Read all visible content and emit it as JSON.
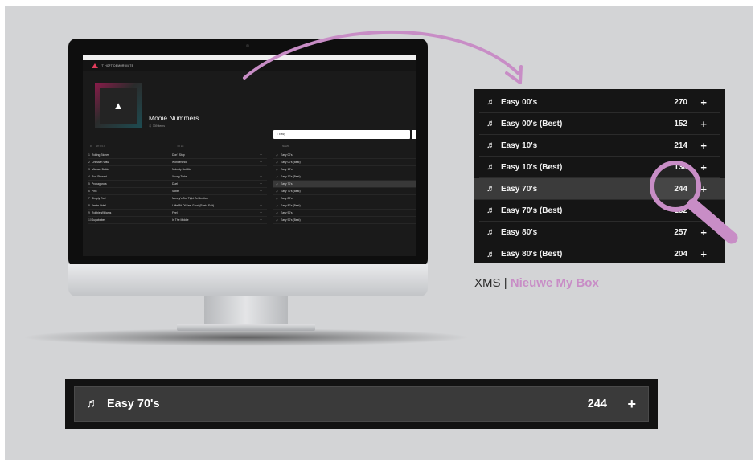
{
  "colors": {
    "accent_pink": "#c88dc6",
    "brand_red": "#e23d5c",
    "panel_dark": "#151515",
    "row_highlight": "#3b3b3b"
  },
  "app": {
    "brand": "'T HOFT DEMORUIMTE",
    "playlist": {
      "title": "Mooie Nummers",
      "meta": "339 items"
    },
    "search": {
      "value": "Easy"
    },
    "columns": {
      "number": "#",
      "artist": "ARTIST",
      "title": "TITLE",
      "name": "NAME"
    },
    "tracks": [
      {
        "num": "1",
        "artist": "Rolling Stones",
        "title": "Don't Stop"
      },
      {
        "num": "2",
        "artist": "Christian Walz",
        "title": "Wonderchild"
      },
      {
        "num": "3",
        "artist": "Michael Buble",
        "title": "Nobody But Me"
      },
      {
        "num": "4",
        "artist": "Rod Stewart",
        "title": "Young Turks"
      },
      {
        "num": "5",
        "artist": "Propaganda",
        "title": "Duel"
      },
      {
        "num": "6",
        "artist": "Pink",
        "title": "Sober"
      },
      {
        "num": "7",
        "artist": "Simply Red",
        "title": "Money's Too Tight To Mention"
      },
      {
        "num": "8",
        "artist": "Jamie Lidell",
        "title": "Little Bit Of Feel Good (Basta Edit)"
      },
      {
        "num": "9",
        "artist": "Robbie Williams",
        "title": "Feel"
      },
      {
        "num": "10",
        "artist": "Sugababes",
        "title": "In The Middle"
      }
    ],
    "library": [
      {
        "name": "Easy 00's"
      },
      {
        "name": "Easy 00's (Best)"
      },
      {
        "name": "Easy 10's"
      },
      {
        "name": "Easy 10's (Best)"
      },
      {
        "name": "Easy 70's"
      },
      {
        "name": "Easy 70's (Best)"
      },
      {
        "name": "Easy 80's"
      },
      {
        "name": "Easy 80's (Best)"
      },
      {
        "name": "Easy 90's"
      },
      {
        "name": "Easy 90's (Best)"
      }
    ]
  },
  "zoom": {
    "rows": [
      {
        "name": "Easy 00's",
        "count": "270"
      },
      {
        "name": "Easy 00's (Best)",
        "count": "152"
      },
      {
        "name": "Easy 10's",
        "count": "214"
      },
      {
        "name": "Easy 10's (Best)",
        "count": "130"
      },
      {
        "name": "Easy 70's",
        "count": "244"
      },
      {
        "name": "Easy 70's (Best)",
        "count": "152"
      },
      {
        "name": "Easy 80's",
        "count": "257"
      },
      {
        "name": "Easy 80's (Best)",
        "count": "204"
      }
    ],
    "plus": "+",
    "note_glyph": "♬"
  },
  "caption": {
    "prefix": "XMS",
    "separator": "|",
    "highlight": "Nieuwe My Box"
  },
  "bottom": {
    "name": "Easy 70's",
    "count": "244",
    "plus": "+",
    "note_glyph": "♬"
  }
}
